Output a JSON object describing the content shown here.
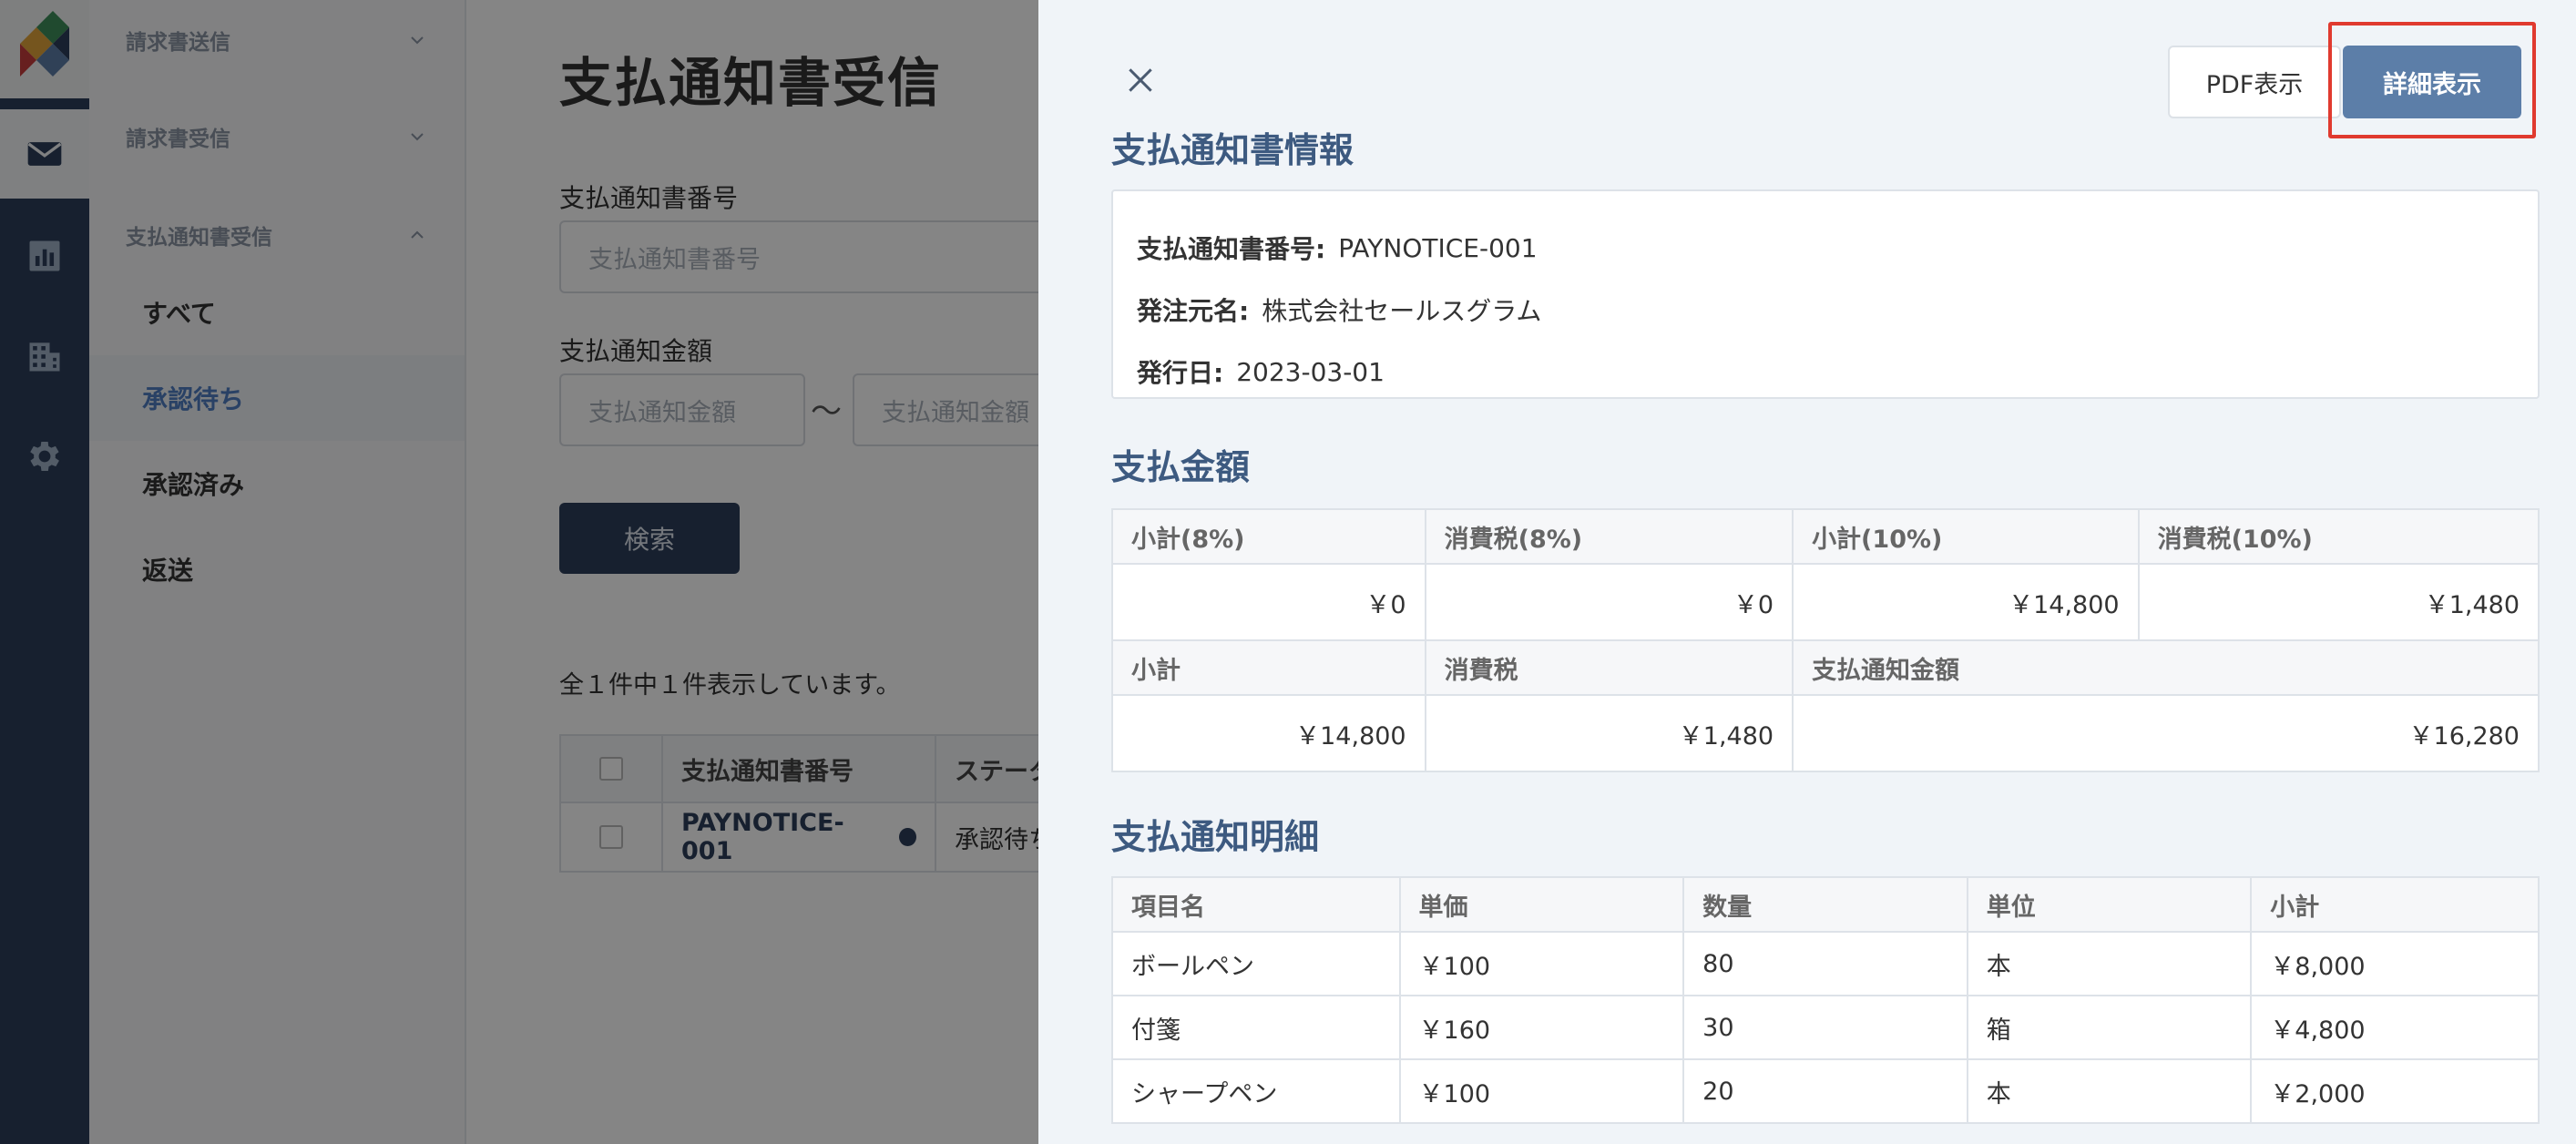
{
  "sidebar": {
    "groups": [
      {
        "label": "請求書送信",
        "expanded": false
      },
      {
        "label": "請求書受信",
        "expanded": false
      },
      {
        "label": "支払通知書受信",
        "expanded": true
      }
    ],
    "sub_items": [
      {
        "label": "すべて",
        "active": false
      },
      {
        "label": "承認待ち",
        "active": true
      },
      {
        "label": "承認済み",
        "active": false
      },
      {
        "label": "返送",
        "active": false
      }
    ]
  },
  "main": {
    "title": "支払通知書受信",
    "number_label": "支払通知書番号",
    "number_placeholder": "支払通知書番号",
    "amount_label": "支払通知金額",
    "amount_min_placeholder": "支払通知金額",
    "amount_max_placeholder": "支払通知金額",
    "tilde": "〜",
    "search_label": "検索",
    "result_text": "全１件中１件表示しています。",
    "table": {
      "headers": [
        "支払通知書番号",
        "ステータス"
      ],
      "rows": [
        {
          "number": "PAYNOTICE-001",
          "status": "承認待ち"
        }
      ]
    }
  },
  "drawer": {
    "pdf_label": "PDF表示",
    "detail_label": "詳細表示",
    "info": {
      "title": "支払通知書情報",
      "number_label": "支払通知書番号:",
      "number_value": "PAYNOTICE-001",
      "orderer_label": "発注元名:",
      "orderer_value": "株式会社セールスグラム",
      "date_label": "発行日:",
      "date_value": "2023-03-01"
    },
    "amount": {
      "title": "支払金額",
      "row1_headers": [
        "小計(8%)",
        "消費税(8%)",
        "小計(10%)",
        "消費税(10%)"
      ],
      "row1_values": [
        "￥0",
        "￥0",
        "￥14,800",
        "￥1,480"
      ],
      "row2_headers": [
        "小計",
        "消費税",
        "支払通知金額"
      ],
      "row2_values": [
        "￥14,800",
        "￥1,480",
        "￥16,280"
      ]
    },
    "items": {
      "title": "支払通知明細",
      "headers": [
        "項目名",
        "単価",
        "数量",
        "単位",
        "小計"
      ],
      "rows": [
        [
          "ボールペン",
          "￥100",
          "80",
          "本",
          "￥8,000"
        ],
        [
          "付箋",
          "￥160",
          "30",
          "箱",
          "￥4,800"
        ],
        [
          "シャープペン",
          "￥100",
          "20",
          "本",
          "￥2,000"
        ]
      ]
    }
  },
  "colors": {
    "rail": "#2d3f5a",
    "accent": "#5c7ea8",
    "section_title": "#3d5a80",
    "highlight": "#e03a2f"
  },
  "icons": [
    "logo-icon",
    "mail-icon",
    "chart-icon",
    "building-icon",
    "gear-icon",
    "chevron-down-icon",
    "chevron-up-icon",
    "close-icon"
  ]
}
